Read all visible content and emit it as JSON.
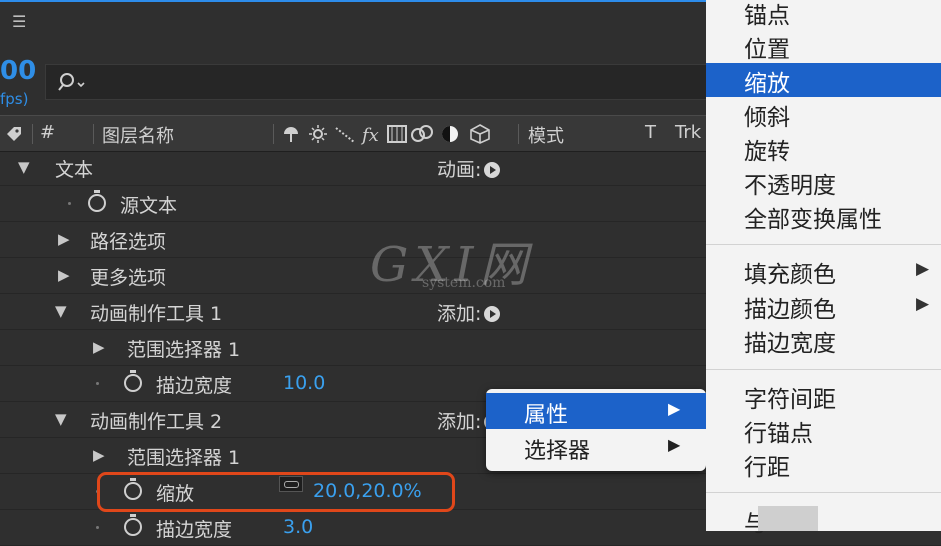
{
  "topbar": {
    "menu_icon": "hamburger-icon"
  },
  "timecode": {
    "main": "00",
    "fps": "fps)"
  },
  "search": {
    "icon": "search-icon",
    "placeholder": ""
  },
  "columns": {
    "hash": "#",
    "layer_name": "图层名称",
    "mode": "模式",
    "t": "T",
    "trk": "Trk"
  },
  "rows": [
    {
      "label": "文本",
      "right_label": "动画:"
    },
    {
      "label": "源文本"
    },
    {
      "label": "路径选项"
    },
    {
      "label": "更多选项"
    },
    {
      "label": "动画制作工具 1",
      "right_label": "添加:"
    },
    {
      "label": "范围选择器 1"
    },
    {
      "label": "描边宽度",
      "value": "10.0"
    },
    {
      "label": "动画制作工具 2",
      "right_label": "添加:"
    },
    {
      "label": "范围选择器 1"
    },
    {
      "label": "缩放",
      "value": "20.0,20.0%"
    },
    {
      "label": "描边宽度",
      "value": "3.0"
    }
  ],
  "context_menu": {
    "items": [
      {
        "label": "属性",
        "arrow": "▶",
        "selected": true
      },
      {
        "label": "选择器",
        "arrow": "▶",
        "selected": false
      }
    ]
  },
  "property_menu": {
    "items": [
      {
        "label": "锚点"
      },
      {
        "label": "位置"
      },
      {
        "label": "缩放",
        "selected": true
      },
      {
        "label": "倾斜"
      },
      {
        "label": "旋转"
      },
      {
        "label": "不透明度"
      },
      {
        "label": "全部变换属性"
      },
      {
        "label": "填充颜色",
        "arrow": "▶"
      },
      {
        "label": "描边颜色",
        "arrow": "▶"
      },
      {
        "label": "描边宽度"
      },
      {
        "label": "字符间距"
      },
      {
        "label": "行锚点"
      },
      {
        "label": "行距"
      },
      {
        "label": "与"
      }
    ]
  },
  "watermark": {
    "big": "GXI网",
    "small": "system.com"
  },
  "colors": {
    "accent": "#2f8ee6",
    "selection": "#1c62c9",
    "highlight_ring": "#e0471a",
    "value": "#3aa0ee"
  }
}
